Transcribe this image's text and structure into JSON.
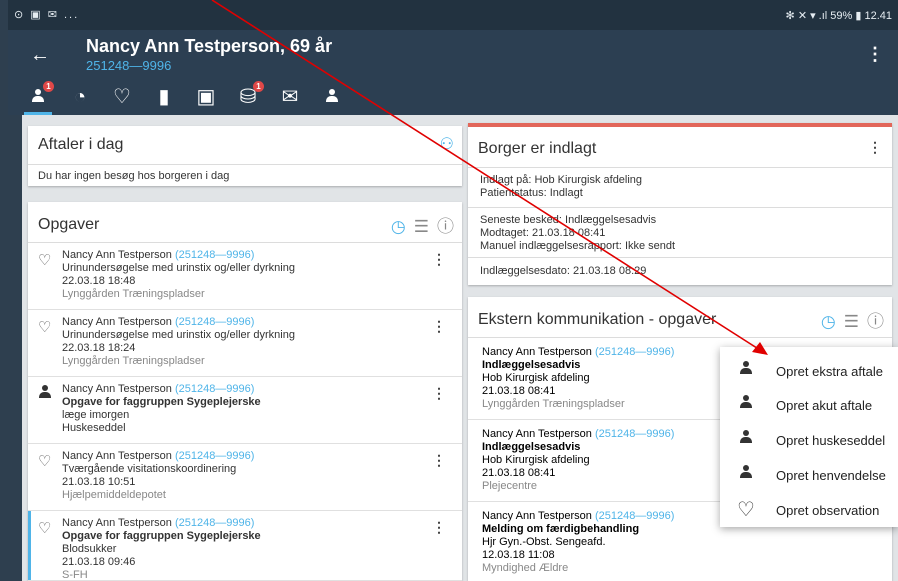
{
  "statusbar": {
    "left": "⊙ ▣ ✉ ...",
    "right": "✻ ✕ ▾ .ıl 59% ▮ 12.41"
  },
  "header": {
    "name": "Nancy Ann Testperson, 69 år",
    "cpr": "251248—9996"
  },
  "iconbar": [
    {
      "icon": "person-icon",
      "glyph": "👤",
      "badge": "1"
    },
    {
      "icon": "cycle-icon",
      "glyph": "◔",
      "badge": ""
    },
    {
      "icon": "heart-icon",
      "glyph": "♡",
      "badge": ""
    },
    {
      "icon": "bookmark-icon",
      "glyph": "▮",
      "badge": ""
    },
    {
      "icon": "calendar-icon",
      "glyph": "▣",
      "badge": ""
    },
    {
      "icon": "medicine-icon",
      "glyph": "⛁",
      "badge": "1"
    },
    {
      "icon": "mail-icon",
      "glyph": "✉",
      "badge": ""
    },
    {
      "icon": "person-lock-icon",
      "glyph": "👤",
      "badge": ""
    }
  ],
  "aftaler": {
    "title": "Aftaler i dag",
    "empty": "Du har ingen besøg hos borgeren i dag"
  },
  "opgaver": {
    "title": "Opgaver",
    "items": [
      {
        "icon": "heart-icon",
        "name": "Nancy Ann Testperson",
        "cpr": "(251248—9996)",
        "desc": "Urinundersøgelse med urinstix og/eller dyrkning",
        "extra": "",
        "date": "22.03.18 18:48",
        "loc": "Lynggården Træningspladser"
      },
      {
        "icon": "heart-icon",
        "name": "Nancy Ann Testperson",
        "cpr": "(251248—9996)",
        "desc": "Urinundersøgelse med urinstix og/eller dyrkning",
        "extra": "",
        "date": "22.03.18 18:24",
        "loc": "Lynggården Træningspladser"
      },
      {
        "icon": "person-icon",
        "name": "Nancy Ann Testperson",
        "cpr": "(251248—9996)",
        "desc": "Opgave for faggruppen Sygeplejerske",
        "extra": "læge imorgen",
        "date": "",
        "loc": "Huskeseddel"
      },
      {
        "icon": "heart-icon",
        "name": "Nancy Ann Testperson",
        "cpr": "(251248—9996)",
        "desc": "Tværgående visitationskoordinering",
        "extra": "",
        "date": "21.03.18 10:51",
        "loc": "Hjælpemiddeldepotet"
      },
      {
        "icon": "heart-icon",
        "name": "Nancy Ann Testperson",
        "cpr": "(251248—9996)",
        "desc": "Opgave for faggruppen Sygeplejerske",
        "extra": "Blodsukker",
        "date": "21.03.18 09:46",
        "loc": "S-FH"
      }
    ]
  },
  "indlagt": {
    "title": "Borger er indlagt",
    "l1": "Indlagt på:",
    "v1": "Hob Kirurgisk afdeling",
    "l2": "Patientstatus:",
    "v2": "Indlagt",
    "l3": "Seneste besked:",
    "v3": "Indlæggelsesadvis",
    "l4": "Modtaget:",
    "v4": "21.03.18 08:41",
    "l5": "Manuel indlæggelsesrapport:",
    "v5": "Ikke sendt",
    "l6": "Indlæggelsesdato:",
    "v6": "21.03.18 08:29"
  },
  "ekstern": {
    "title": "Ekstern kommunikation - opgaver",
    "items": [
      {
        "name": "Nancy Ann Testperson",
        "cpr": "(251248—9996)",
        "type": "Indlæggelsesadvis",
        "dept": "Hob Kirurgisk afdeling",
        "date": "21.03.18 08:41",
        "loc": "Lynggården Træningspladser"
      },
      {
        "name": "Nancy Ann Testperson",
        "cpr": "(251248—9996)",
        "type": "Indlæggelsesadvis",
        "dept": "Hob Kirurgisk afdeling",
        "date": "21.03.18 08:41",
        "loc": "Plejecentre"
      },
      {
        "name": "Nancy Ann Testperson",
        "cpr": "(251248—9996)",
        "type": "Melding om færdigbehandling",
        "dept": "Hjr Gyn.-Obst. Sengeafd.",
        "date": "12.03.18 11:08",
        "loc": "Myndighed Ældre"
      }
    ]
  },
  "menu": [
    {
      "label": "Opret ekstra aftale",
      "icon": "person-icon"
    },
    {
      "label": "Opret akut aftale",
      "icon": "person-icon"
    },
    {
      "label": "Opret huskeseddel",
      "icon": "person-icon"
    },
    {
      "label": "Opret henvendelse",
      "icon": "person-icon"
    },
    {
      "label": "Opret observation",
      "icon": "heart-icon"
    }
  ],
  "colors": {
    "header": "#2c3f52",
    "accent": "#4fb4e8",
    "badge": "#e04848",
    "annotation": "#e00000",
    "alert_bar": "#e2675a"
  }
}
